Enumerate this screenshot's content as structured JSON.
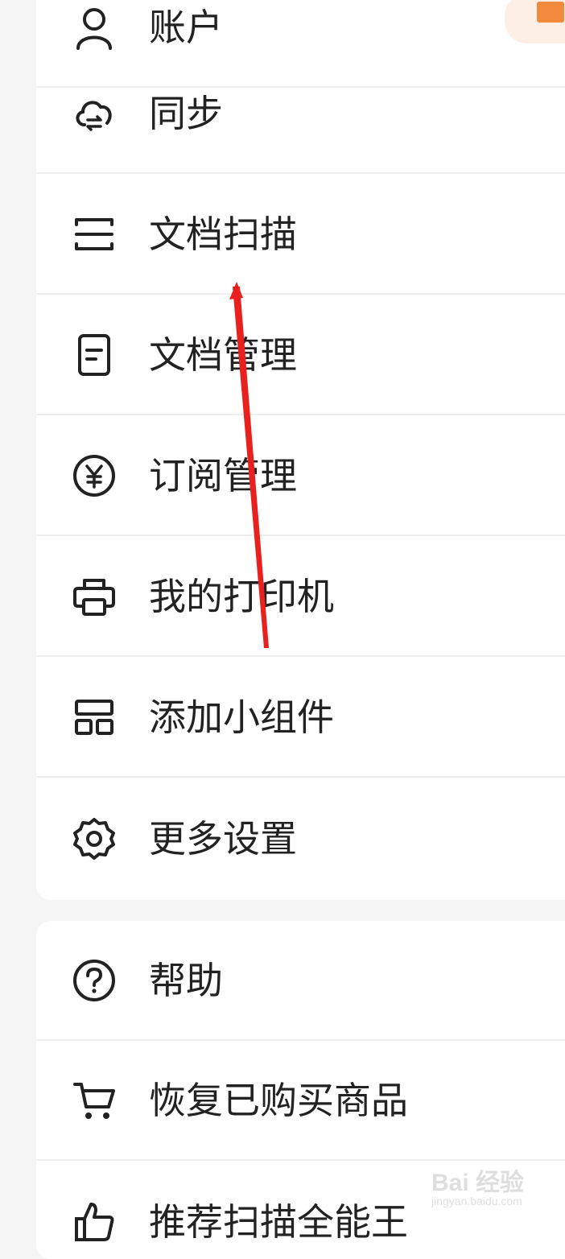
{
  "menu_primary": {
    "items": [
      {
        "label": "账户",
        "icon": "account-icon"
      },
      {
        "label": "同步",
        "icon": "cloud-sync-icon"
      },
      {
        "label": "文档扫描",
        "icon": "scan-icon"
      },
      {
        "label": "文档管理",
        "icon": "document-icon"
      },
      {
        "label": "订阅管理",
        "icon": "yen-circle-icon"
      },
      {
        "label": "我的打印机",
        "icon": "printer-icon"
      },
      {
        "label": "添加小组件",
        "icon": "widget-icon"
      },
      {
        "label": "更多设置",
        "icon": "gear-icon"
      }
    ]
  },
  "menu_secondary": {
    "items": [
      {
        "label": "帮助",
        "icon": "help-icon"
      },
      {
        "label": "恢复已购买商品",
        "icon": "cart-icon"
      },
      {
        "label": "推荐扫描全能王",
        "icon": "thumbs-up-icon"
      }
    ]
  },
  "badge": {
    "icon": "gift-icon",
    "color": "#f08a3c"
  },
  "annotation": {
    "color": "#e8201e"
  },
  "watermark": {
    "brand": "Bai 经验",
    "site": "jingyan.baidu.com"
  }
}
